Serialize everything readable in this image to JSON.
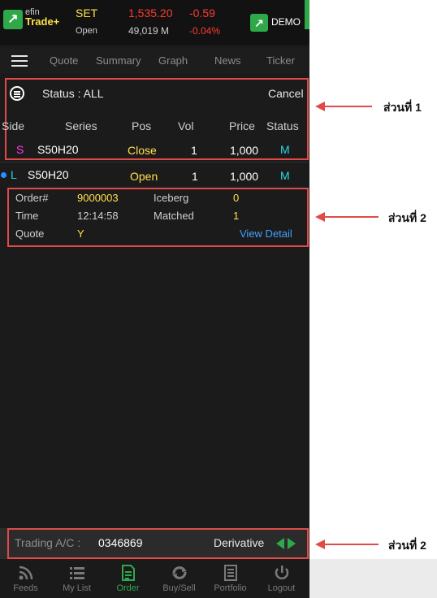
{
  "header": {
    "logo_small": "efin",
    "logo_big": "Trade+",
    "market": "SET",
    "market_state": "Open",
    "index": "1,535.20",
    "volume": "49,019 M",
    "change": "-0.59",
    "change_pct": "-0.04%",
    "mode": "DEMO"
  },
  "nav": {
    "tabs": [
      "Quote",
      "Summary",
      "Graph",
      "News",
      "Ticker"
    ]
  },
  "filter": {
    "status_label": "Status : ALL",
    "cancel_label": "Cancel"
  },
  "table": {
    "headers": [
      "Side",
      "Series",
      "Pos",
      "Vol",
      "Price",
      "Status"
    ],
    "rows": [
      {
        "side": "S",
        "series": "S50H20",
        "pos": "Close",
        "vol": "1",
        "price": "1,000",
        "status": "M"
      },
      {
        "side": "L",
        "series": "S50H20",
        "pos": "Open",
        "vol": "1",
        "price": "1,000",
        "status": "M"
      }
    ]
  },
  "detail": {
    "order_label": "Order#",
    "order_value": "9000003",
    "iceberg_label": "Iceberg",
    "iceberg_value": "0",
    "time_label": "Time",
    "time_value": "12:14:58",
    "matched_label": "Matched",
    "matched_value": "1",
    "quote_label": "Quote",
    "quote_value": "Y",
    "view_detail": "View Detail"
  },
  "account": {
    "label": "Trading A/C :",
    "value": "0346869",
    "type": "Derivative"
  },
  "tabbar": {
    "items": [
      {
        "label": "Feeds",
        "icon": "rss-icon"
      },
      {
        "label": "My List",
        "icon": "list-icon"
      },
      {
        "label": "Order",
        "icon": "order-document-icon"
      },
      {
        "label": "Buy/Sell",
        "icon": "swap-icon"
      },
      {
        "label": "Portfolio",
        "icon": "portfolio-icon"
      },
      {
        "label": "Logout",
        "icon": "power-icon"
      }
    ],
    "active": "Order"
  },
  "annotations": {
    "part1": "ส่วนที่ 1",
    "part2a": "ส่วนที่ 2",
    "part2b": "ส่วนที่ 2"
  },
  "colors": {
    "background": "#1b1b1b",
    "accent_green": "#2fa84a",
    "negative_red": "#ff3b30",
    "highlight_yellow": "#ffe14a",
    "status_cyan": "#28d8e6",
    "link_blue": "#3fa3ff",
    "annotation_red": "#e04a48"
  }
}
